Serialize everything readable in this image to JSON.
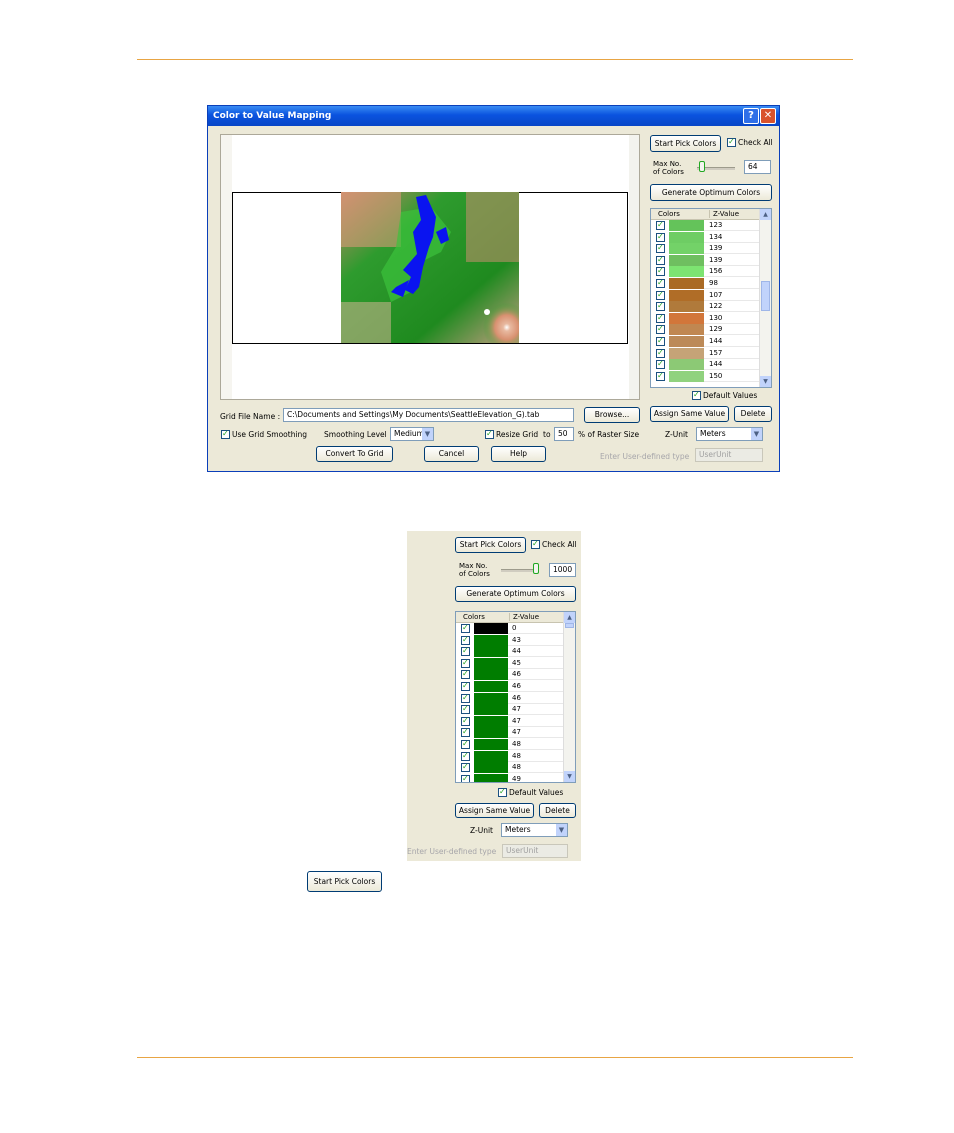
{
  "dialog": {
    "title": "Color to Value Mapping",
    "help_glyph": "?",
    "close_glyph": "✕",
    "start_pick_colors": "Start Pick Colors",
    "check_all": "Check All",
    "max_no_label": "Max No.",
    "of_colors_label": "of Colors",
    "max_colors_value": "64",
    "max_colors_slider_fraction": 0.05,
    "generate_optimum": "Generate Optimum Colors",
    "table": {
      "col_colors": "Colors",
      "col_zvalue": "Z-Value",
      "rows": [
        {
          "color": "#64c35a",
          "z": "123"
        },
        {
          "color": "#6ecd64",
          "z": "134"
        },
        {
          "color": "#73d268",
          "z": "139"
        },
        {
          "color": "#6fbf60",
          "z": "139"
        },
        {
          "color": "#7de471",
          "z": "156"
        },
        {
          "color": "#aa6a24",
          "z": "98"
        },
        {
          "color": "#b06d27",
          "z": "107"
        },
        {
          "color": "#b07a3b",
          "z": "122"
        },
        {
          "color": "#d2763a",
          "z": "130"
        },
        {
          "color": "#c08751",
          "z": "129"
        },
        {
          "color": "#bc8a58",
          "z": "144"
        },
        {
          "color": "#c5a377",
          "z": "157"
        },
        {
          "color": "#8cc975",
          "z": "144"
        },
        {
          "color": "#90d27e",
          "z": "150"
        }
      ]
    },
    "default_values": "Default Values",
    "grid_file_label": "Grid File Name :",
    "grid_file_value": "C:\\Documents and Settings\\My Documents\\SeattleElevation_G).tab",
    "browse": "Browse...",
    "assign_same_value": "Assign Same Value",
    "delete": "Delete",
    "use_grid_smoothing": "Use Grid Smoothing",
    "smoothing_level_label": "Smoothing Level :",
    "smoothing_level_value": "Medium",
    "resize_grid": "Resize Grid",
    "resize_to": "to",
    "resize_value": "50",
    "percent_raster": "% of Raster Size",
    "z_unit_label": "Z-Unit",
    "z_unit_value": "Meters",
    "convert_to_grid": "Convert To Grid",
    "cancel": "Cancel",
    "help": "Help",
    "user_defined_label": "Enter User-defined type",
    "user_defined_value": "UserUnit"
  },
  "panel2": {
    "start_pick_colors": "Start Pick Colors",
    "check_all": "Check All",
    "max_no_label": "Max No.",
    "of_colors_label": "of Colors",
    "max_colors_value": "1000",
    "max_colors_slider_fraction": 1.0,
    "generate_optimum": "Generate Optimum Colors",
    "table": {
      "col_colors": "Colors",
      "col_zvalue": "Z-Value",
      "rows": [
        {
          "color": "#000000",
          "z": "0"
        },
        {
          "color": "#007d00",
          "z": "43"
        },
        {
          "color": "#007d00",
          "z": "44"
        },
        {
          "color": "#007d00",
          "z": "45"
        },
        {
          "color": "#007d00",
          "z": "46"
        },
        {
          "color": "#007d00",
          "z": "46"
        },
        {
          "color": "#007d00",
          "z": "46"
        },
        {
          "color": "#007d00",
          "z": "47"
        },
        {
          "color": "#007d00",
          "z": "47"
        },
        {
          "color": "#007d00",
          "z": "47"
        },
        {
          "color": "#007d00",
          "z": "48"
        },
        {
          "color": "#007d00",
          "z": "48"
        },
        {
          "color": "#007d00",
          "z": "48"
        },
        {
          "color": "#007d00",
          "z": "49"
        }
      ]
    },
    "default_values": "Default Values",
    "assign_same_value": "Assign Same Value",
    "delete": "Delete",
    "z_unit_label": "Z-Unit",
    "z_unit_value": "Meters",
    "user_defined_label": "Enter User-defined type",
    "user_defined_value": "UserUnit"
  },
  "standalone_button": "Start Pick Colors",
  "colors": {
    "rule": "#e8a544",
    "title_bar": "#0a53df",
    "dialog_bg": "#ece9d8",
    "water": "#0a14f0"
  },
  "icons": [
    "help-icon",
    "close-icon",
    "checkbox-icon",
    "dropdown-arrow-icon",
    "scroll-up-icon",
    "scroll-down-icon"
  ]
}
